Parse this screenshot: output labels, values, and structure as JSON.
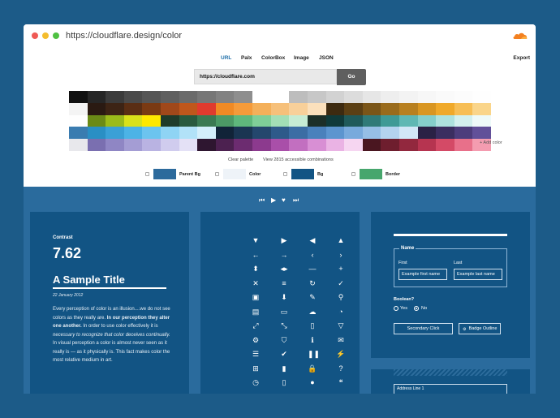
{
  "browser": {
    "url": "https://cloudflare.design/color"
  },
  "tabs": [
    {
      "label": "URL",
      "active": true
    },
    {
      "label": "Palx",
      "active": false
    },
    {
      "label": "ColorBox",
      "active": false
    },
    {
      "label": "Image",
      "active": false
    },
    {
      "label": "JSON",
      "active": false
    }
  ],
  "export_label": "Export",
  "url_input": {
    "value": "https://cloudflare.com"
  },
  "go_label": "Go",
  "palette": {
    "rows": [
      [
        "#111111",
        "#262626",
        "#3b3b3b",
        "#4a4a4a",
        "#555555",
        "#5f5f5f",
        "#6b6b6b",
        "#777777",
        "#828282",
        "#8e8e8e",
        "#ffffff",
        "#ffffff",
        "#bdbdbd",
        "#c7c7c7",
        "#d2d2d2",
        "#dcdcdc",
        "#e6e6e6",
        "#eeeeee",
        "#f3f3f3",
        "#f7f7f7",
        "#fafafa",
        "#fcfcfc",
        "#fefefe"
      ],
      [
        "#f4f4f4",
        "#2a1a12",
        "#3d2415",
        "#5a2e14",
        "#7a3a13",
        "#a0481a",
        "#c0571c",
        "#e03b2e",
        "#f08a24",
        "#f59b3a",
        "#f4b05a",
        "#f6c07a",
        "#f8d09a",
        "#fbe0bc",
        "#3d2a10",
        "#5b3f14",
        "#7a5518",
        "#996b1c",
        "#b88020",
        "#d99622",
        "#f0a92a",
        "#f7be55",
        "#fad58a"
      ],
      [
        "#fefefe",
        "#6b8a16",
        "#9bbb1a",
        "#d9e11a",
        "#ffe800",
        "#1f3b2a",
        "#2a5a3e",
        "#3b7a52",
        "#4c9a66",
        "#5fb87c",
        "#7fcf98",
        "#a3dfb6",
        "#c6ecd4",
        "#1c2f28",
        "#0f3a3a",
        "#1f5a5a",
        "#2f7a78",
        "#3f9a96",
        "#5fb8b4",
        "#85cfcb",
        "#aee2de",
        "#d3f0ee",
        "#eefaf9"
      ],
      [
        "#3a7cb0",
        "#2a8fc4",
        "#3aa0d6",
        "#4cb3e6",
        "#6cc4ef",
        "#8fd4f4",
        "#b2e2f8",
        "#d4effb",
        "#112338",
        "#1a3552",
        "#24476d",
        "#2e5a8a",
        "#3b6da4",
        "#4a81bc",
        "#5c95cf",
        "#78aadc",
        "#96bfe6",
        "#b4d3ef",
        "#d2e7f7",
        "#2a2145",
        "#3b2e60",
        "#4d3d7c",
        "#615099"
      ],
      [
        "#e8e8ec",
        "#7a6fb0",
        "#8f86c4",
        "#a49dd4",
        "#b9b3e2",
        "#d0ccee",
        "#e4e1f6",
        "#2e1630",
        "#4c2150",
        "#6c2c70",
        "#8c3a8e",
        "#a94fa9",
        "#c26fc0",
        "#d88fd4",
        "#eab3e4",
        "#f6d6f1",
        "#4a1620",
        "#6e1e2e",
        "#92283e",
        "#b63450",
        "#d44a66",
        "#e8708a",
        "#f49cb0"
      ]
    ],
    "add_label": "+ Add color"
  },
  "actions": {
    "clear_label": "Clear palette",
    "view_label": "View 2815 accessible combinations"
  },
  "chips": [
    {
      "label": "Parent Bg",
      "color": "#2c6a9c"
    },
    {
      "label": "Color",
      "color": "#eef3f8"
    },
    {
      "label": "Bg",
      "color": "#125484"
    },
    {
      "label": "Border",
      "color": "#47a66d"
    }
  ],
  "player_icons": [
    "skip-back-icon",
    "play-icon",
    "heart-icon",
    "skip-forward-icon"
  ],
  "preview": {
    "contrast_label": "Contrast",
    "contrast_value": "7.62",
    "title": "A Sample Title",
    "date": "22 January 2012",
    "body_parts": [
      {
        "text": "Every perception of color is an illusion....we do not see colors as they really are. ",
        "style": "normal"
      },
      {
        "text": "In our perception they alter one another.",
        "style": "bold"
      },
      {
        "text": " In order to use color effectively it is ",
        "style": "normal"
      },
      {
        "text": "necessary to recognize that color deceives continually.",
        "style": "italic"
      },
      {
        "text": " In visual perception a color is almost never seen as it really is — as it physically is. This fact makes color the most relative medium in art.",
        "style": "normal"
      }
    ]
  },
  "icons": [
    {
      "glyph": "▼",
      "name": "caret-down-icon"
    },
    {
      "glyph": "▶",
      "name": "caret-right-icon"
    },
    {
      "glyph": "◀",
      "name": "caret-left-icon"
    },
    {
      "glyph": "▲",
      "name": "caret-up-icon"
    },
    {
      "glyph": "←",
      "name": "arrow-left-icon"
    },
    {
      "glyph": "→",
      "name": "arrow-right-icon"
    },
    {
      "glyph": "‹",
      "name": "chevron-left-icon"
    },
    {
      "glyph": "›",
      "name": "chevron-right-icon"
    },
    {
      "glyph": "⬍",
      "name": "sort-icon"
    },
    {
      "glyph": "◂▸",
      "name": "code-icon"
    },
    {
      "glyph": "—",
      "name": "minus-icon"
    },
    {
      "glyph": "+",
      "name": "plus-icon"
    },
    {
      "glyph": "✕",
      "name": "close-icon"
    },
    {
      "glyph": "≡",
      "name": "menu-icon"
    },
    {
      "glyph": "↻",
      "name": "refresh-icon"
    },
    {
      "glyph": "✓",
      "name": "check-icon"
    },
    {
      "glyph": "▣",
      "name": "table-icon"
    },
    {
      "glyph": "⬇",
      "name": "download-icon"
    },
    {
      "glyph": "✎",
      "name": "wrench-icon"
    },
    {
      "glyph": "⚲",
      "name": "location-icon"
    },
    {
      "glyph": "▤",
      "name": "chat-icon"
    },
    {
      "glyph": "▭",
      "name": "credit-card-icon"
    },
    {
      "glyph": "☁",
      "name": "cloud-upload-icon"
    },
    {
      "glyph": "◔",
      "name": "pie-chart-icon"
    },
    {
      "glyph": "⤢",
      "name": "expand-icon"
    },
    {
      "glyph": "⤡",
      "name": "collapse-icon"
    },
    {
      "glyph": "▯",
      "name": "document-icon"
    },
    {
      "glyph": "▽",
      "name": "filter-icon"
    },
    {
      "glyph": "⚙",
      "name": "gear-icon"
    },
    {
      "glyph": "⛉",
      "name": "shield-icon"
    },
    {
      "glyph": "ℹ",
      "name": "info-icon"
    },
    {
      "glyph": "✉",
      "name": "mail-icon"
    },
    {
      "glyph": "☰",
      "name": "list-icon"
    },
    {
      "glyph": "✔",
      "name": "check-circle-icon"
    },
    {
      "glyph": "❚❚",
      "name": "pause-icon"
    },
    {
      "glyph": "⚡",
      "name": "bolt-icon"
    },
    {
      "glyph": "⊞",
      "name": "sitemap-icon"
    },
    {
      "glyph": "▮",
      "name": "book-icon"
    },
    {
      "glyph": "🔒",
      "name": "lock-icon"
    },
    {
      "glyph": "?",
      "name": "help-icon"
    },
    {
      "glyph": "◷",
      "name": "clock-icon"
    },
    {
      "glyph": "▯",
      "name": "page-icon"
    },
    {
      "glyph": "●",
      "name": "user-icon"
    },
    {
      "glyph": "❝",
      "name": "quote-icon"
    }
  ],
  "form": {
    "legend": "Name",
    "first_label": "First",
    "first_placeholder": "Example first name",
    "last_label": "Last",
    "last_placeholder": "Example last name",
    "boolean_label": "Boolean?",
    "yes_label": "Yes",
    "no_label": "No",
    "secondary_label": "Secondary Click",
    "badge_label": "Badge Outline"
  },
  "address_label": "Address Line 1"
}
